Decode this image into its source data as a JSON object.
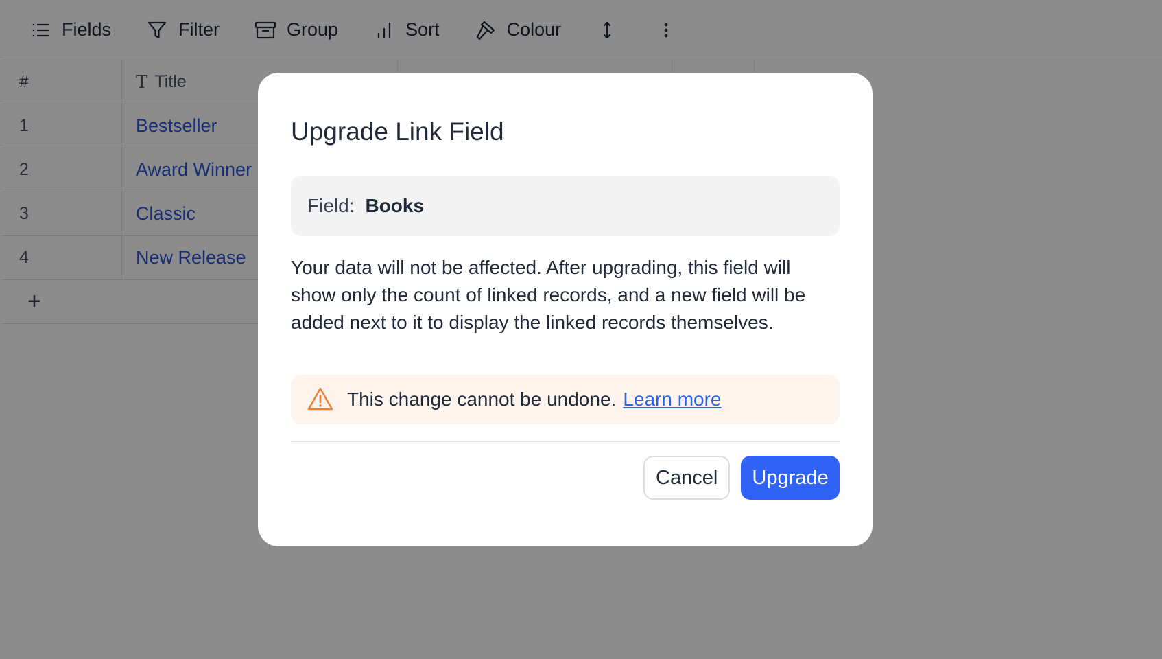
{
  "toolbar": {
    "items": [
      {
        "label": "Fields",
        "icon": "list-icon"
      },
      {
        "label": "Filter",
        "icon": "filter-icon"
      },
      {
        "label": "Group",
        "icon": "archive-icon"
      },
      {
        "label": "Sort",
        "icon": "bar-chart-icon"
      },
      {
        "label": "Colour",
        "icon": "paintbrush-icon"
      }
    ],
    "row_height_icon": "arrows-vertical-icon",
    "more_icon": "more-vertical-icon"
  },
  "grid": {
    "headers": {
      "num": "#",
      "title": "Title"
    },
    "rows": [
      {
        "num": "1",
        "title": "Bestseller"
      },
      {
        "num": "2",
        "title": "Award Winner"
      },
      {
        "num": "3",
        "title": "Classic"
      },
      {
        "num": "4",
        "title": "New Release"
      }
    ],
    "add_label": "+"
  },
  "modal": {
    "title": "Upgrade Link Field",
    "field_label": "Field:",
    "field_value": "Books",
    "description": "Your data will not be affected. After upgrading, this field will show only the count of linked records, and a new field will be added next to it to display the linked records themselves.",
    "warning_text": "This change cannot be undone.",
    "warning_link": "Learn more",
    "cancel_label": "Cancel",
    "upgrade_label": "Upgrade"
  },
  "colors": {
    "accent": "#2f62f5",
    "link": "#2b55d6",
    "warning_bg": "#fef4ee",
    "warning_icon": "#e8823a",
    "overlay": "rgba(0,0,0,0.45)"
  }
}
